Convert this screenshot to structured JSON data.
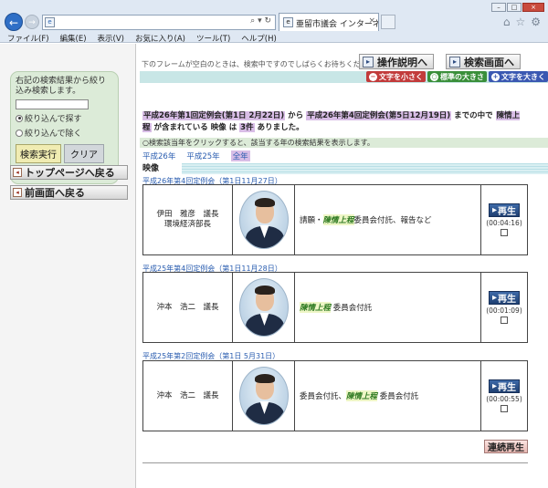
{
  "browser": {
    "tab_title": "亜留市議会 インターネッ...",
    "menu": [
      "ファイル(F)",
      "編集(E)",
      "表示(V)",
      "お気に入り(A)",
      "ツール(T)",
      "ヘルプ(H)"
    ],
    "window_controls": [
      "minimize-icon",
      "maximize-icon",
      "close-icon"
    ]
  },
  "left": {
    "filter_desc": "右記の検索結果から絞り込み検索します。",
    "radio_narrow": "絞り込んで探す",
    "radio_exclude": "絞り込んで除く",
    "exec_label": "検索実行",
    "clear_label": "クリア",
    "top_page": "トップページへ戻る",
    "prev_page": "前画面へ戻る"
  },
  "main": {
    "notice": "下のフレームが空白のときは、検索中ですのでしばらくお待ちください。",
    "help_button": "操作説明へ",
    "search_screen_button": "検索画面へ",
    "font_small": "文字を小さく",
    "font_standard": "標準の大きさ",
    "font_large": "文字を大きく",
    "summary": {
      "from": "平成26年第1回定例会(第1日 2月22日)",
      "from_suffix": "から",
      "to": "平成26年第4回定例会(第5日12月19日)",
      "to_suffix": "までの中で",
      "keyword": "陳情上程",
      "mid": "が含まれている",
      "media": "映像",
      "ha": "は",
      "count": "3件",
      "end": "ありました。"
    },
    "hint": "○検索該当年をクリックすると、該当する年の検索結果を表示します。",
    "years": [
      "平成26年",
      "平成25年",
      "全年"
    ],
    "section": "映像",
    "records": [
      {
        "title": "平成26年第4回定例会（第1日11月27日）",
        "speaker_line1": "伊田　雅彦　議長",
        "speaker_line2": "環境経済部長",
        "content_before": "請願・",
        "keyword": "陳情上程",
        "content_after": "委員会付託、報告など",
        "play": "再生",
        "duration": "(00:04:16)"
      },
      {
        "title": "平成25年第4回定例会（第1日11月28日）",
        "speaker_line1": "沖本　浩二　議長",
        "speaker_line2": "",
        "content_before": "",
        "keyword": "陳情上程",
        "content_after": "委員会付託",
        "play": "再生",
        "duration": "(00:01:09)"
      },
      {
        "title": "平成25年第2回定例会（第1日 5月31日）",
        "speaker_line1": "沖本　浩二　議長",
        "speaker_line2": "",
        "content_before": "委員会付託、",
        "keyword": "陳情上程",
        "content_after": "委員会付託",
        "play": "再生",
        "duration": "(00:00:55)"
      }
    ],
    "continuous_play": "連続再生"
  }
}
